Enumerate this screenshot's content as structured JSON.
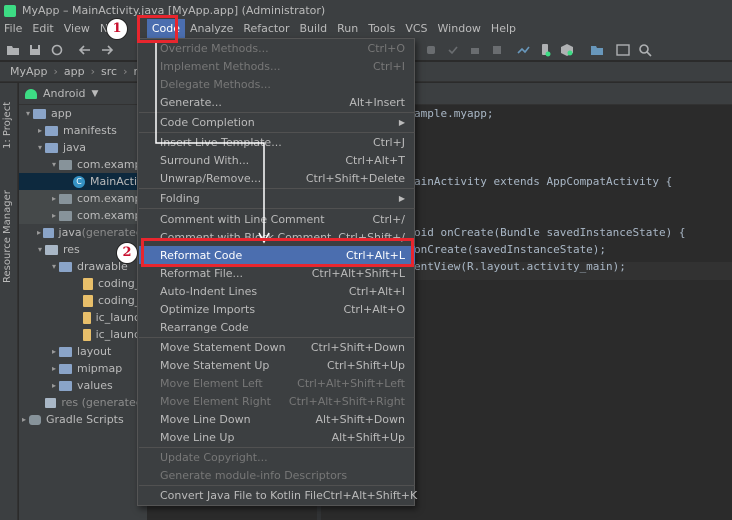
{
  "window": {
    "title": "MyApp – MainActivity.java [MyApp.app] (Administrator)"
  },
  "menubar": {
    "items": [
      {
        "label": "File",
        "active": false
      },
      {
        "label": "Edit",
        "active": false
      },
      {
        "label": "View",
        "active": false
      },
      {
        "label": "Na",
        "active": false
      },
      {
        "label": "Code",
        "active": true
      },
      {
        "label": "Analyze",
        "active": false
      },
      {
        "label": "Refactor",
        "active": false
      },
      {
        "label": "Build",
        "active": false
      },
      {
        "label": "Run",
        "active": false
      },
      {
        "label": "Tools",
        "active": false
      },
      {
        "label": "VCS",
        "active": false
      },
      {
        "label": "Window",
        "active": false
      },
      {
        "label": "Help",
        "active": false
      }
    ]
  },
  "breadcrumb": {
    "items": [
      "MyApp",
      "app",
      "src",
      "main"
    ]
  },
  "left_strip": {
    "project_tab": "1: Project",
    "resource_tab": "Resource Manager"
  },
  "project_panel": {
    "view_mode": "Android",
    "tree": [
      {
        "label": "app",
        "icon": "folder",
        "arrow": "▾"
      },
      {
        "label": "manifests",
        "icon": "folder",
        "arrow": "▸"
      },
      {
        "label": "java",
        "icon": "folder",
        "arrow": "▾"
      },
      {
        "label": "com.exampl",
        "icon": "package",
        "arrow": "▾"
      },
      {
        "label": "MainActiv",
        "icon": "class",
        "arrow": ""
      },
      {
        "label": "com.exampl",
        "icon": "package",
        "arrow": "▸"
      },
      {
        "label": "com.exampl",
        "icon": "package",
        "arrow": "▸"
      },
      {
        "label": "java",
        "suffix": " (generated)",
        "icon": "folder",
        "arrow": "▸"
      },
      {
        "label": "res",
        "icon": "res",
        "arrow": "▾"
      },
      {
        "label": "drawable",
        "icon": "folder",
        "arrow": "▾"
      },
      {
        "label": "coding_c",
        "icon": "xml",
        "arrow": ""
      },
      {
        "label": "coding_c",
        "icon": "xml",
        "arrow": ""
      },
      {
        "label": "ic_launch",
        "icon": "xml",
        "arrow": ""
      },
      {
        "label": "ic_launch",
        "icon": "xml",
        "arrow": ""
      },
      {
        "label": "layout",
        "icon": "folder",
        "arrow": "▸"
      },
      {
        "label": "mipmap",
        "icon": "folder",
        "arrow": "▸"
      },
      {
        "label": "values",
        "icon": "folder",
        "arrow": "▸"
      },
      {
        "label": "res (generated)",
        "icon": "res",
        "arrow": ""
      },
      {
        "label": "Gradle Scripts",
        "icon": "gradle",
        "arrow": "▸"
      }
    ]
  },
  "editor": {
    "lines": [
      {
        "text": "ample.myapp;"
      },
      {
        "text": "ainActivity extends AppCompatActivity {"
      },
      {
        "text": "oid onCreate(Bundle savedInstanceState) {"
      },
      {
        "text": "onCreate(savedInstanceState);"
      },
      {
        "text": "entView(R.layout.activity_main);"
      }
    ]
  },
  "code_menu": {
    "items": [
      {
        "label": "Override Methods...",
        "shortcut": "Ctrl+O",
        "disabled": true
      },
      {
        "label": "Implement Methods...",
        "shortcut": "Ctrl+I",
        "disabled": true
      },
      {
        "label": "Delegate Methods...",
        "shortcut": "",
        "disabled": true
      },
      {
        "label": "Generate...",
        "shortcut": "Alt+Insert",
        "disabled": false
      },
      {
        "label": "Code Completion",
        "shortcut": "",
        "submenu": true
      },
      {
        "label": "Insert Live Template...",
        "shortcut": "Ctrl+J"
      },
      {
        "label": "Surround With...",
        "shortcut": "Ctrl+Alt+T"
      },
      {
        "label": "Unwrap/Remove...",
        "shortcut": "Ctrl+Shift+Delete"
      },
      {
        "label": "Folding",
        "shortcut": "",
        "submenu": true
      },
      {
        "label": "Comment with Line Comment",
        "shortcut": "Ctrl+/"
      },
      {
        "label": "Comment with Block Comment",
        "shortcut": "Ctrl+Shift+/"
      },
      {
        "label": "Reformat Code",
        "shortcut": "Ctrl+Alt+L",
        "selected": true
      },
      {
        "label": "Reformat File...",
        "shortcut": "Ctrl+Alt+Shift+L"
      },
      {
        "label": "Auto-Indent Lines",
        "shortcut": "Ctrl+Alt+I"
      },
      {
        "label": "Optimize Imports",
        "shortcut": "Ctrl+Alt+O"
      },
      {
        "label": "Rearrange Code",
        "shortcut": ""
      },
      {
        "label": "Move Statement Down",
        "shortcut": "Ctrl+Shift+Down"
      },
      {
        "label": "Move Statement Up",
        "shortcut": "Ctrl+Shift+Up"
      },
      {
        "label": "Move Element Left",
        "shortcut": "Ctrl+Alt+Shift+Left",
        "disabled": true
      },
      {
        "label": "Move Element Right",
        "shortcut": "Ctrl+Alt+Shift+Right",
        "disabled": true
      },
      {
        "label": "Move Line Down",
        "shortcut": "Alt+Shift+Down"
      },
      {
        "label": "Move Line Up",
        "shortcut": "Alt+Shift+Up"
      },
      {
        "label": "Update Copyright...",
        "shortcut": "",
        "disabled": true
      },
      {
        "label": "Generate module-info Descriptors",
        "shortcut": "",
        "disabled": true
      },
      {
        "label": "Convert Java File to Kotlin File",
        "shortcut": "Ctrl+Alt+Shift+K"
      }
    ]
  },
  "annotations": {
    "step1": "1",
    "step2": "2",
    "highlight_color": "#e8262e"
  },
  "colors": {
    "menu_selected": "#4b6eaf",
    "panel_bg": "#3c3f41",
    "editor_bg": "#2b2b2b"
  }
}
